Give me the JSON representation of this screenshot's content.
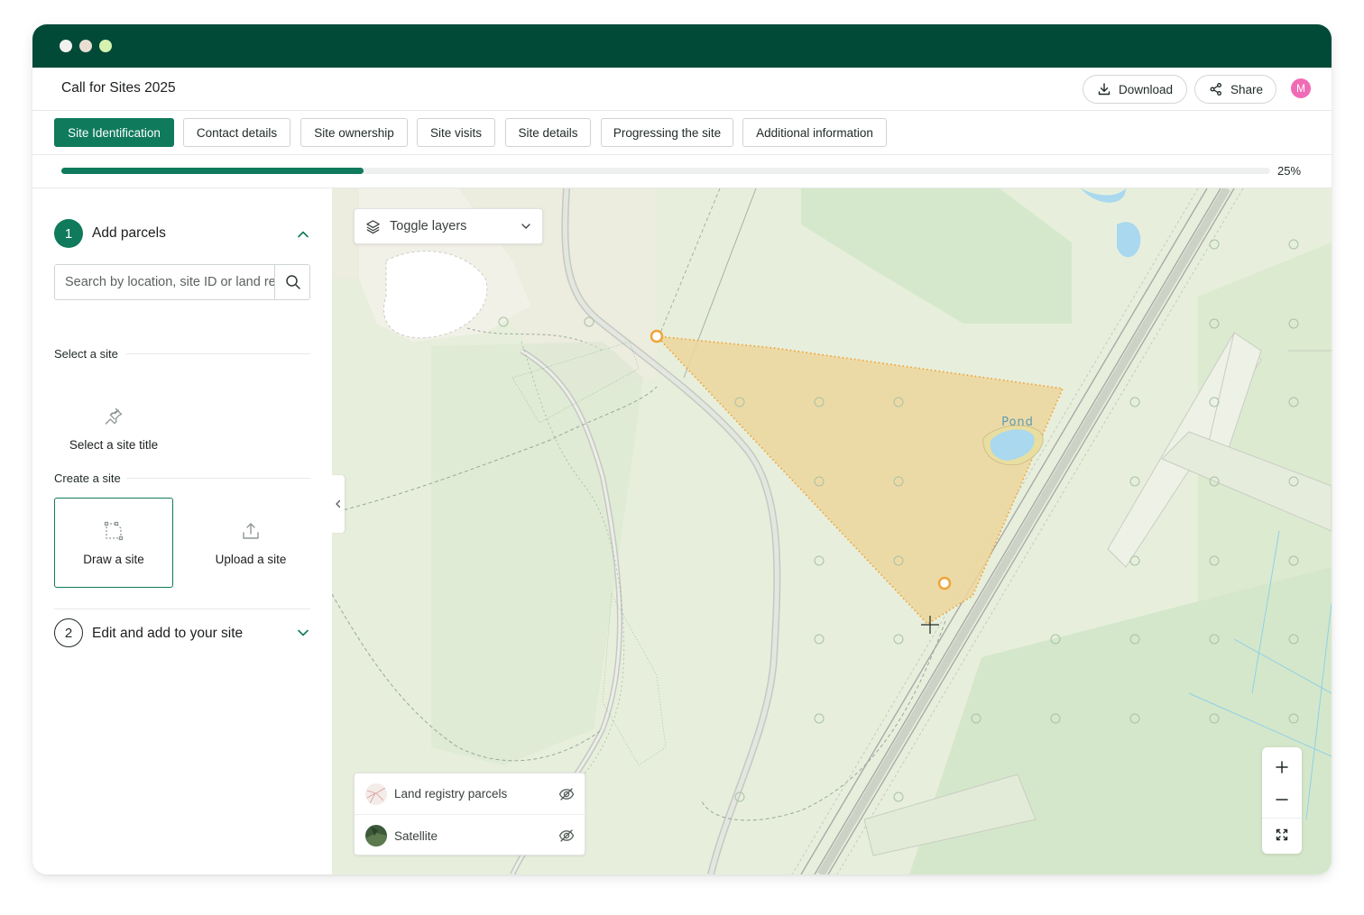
{
  "window": {
    "dots": [
      {
        "name": "window-close-dot",
        "color": "#f1f1ee"
      },
      {
        "name": "window-minimize-dot",
        "color": "#e8dfd2"
      },
      {
        "name": "window-zoom-dot",
        "color": "#d6f2b0"
      }
    ]
  },
  "header": {
    "title": "Call for Sites 2025",
    "download_label": "Download",
    "share_label": "Share",
    "avatar_initial": "M",
    "icons": {
      "download": "download-icon",
      "share": "share-icon"
    }
  },
  "tabs": [
    {
      "label": "Site Identification",
      "active": true
    },
    {
      "label": "Contact details",
      "active": false
    },
    {
      "label": "Site ownership",
      "active": false
    },
    {
      "label": "Site visits",
      "active": false
    },
    {
      "label": "Site details",
      "active": false
    },
    {
      "label": "Progressing the site",
      "active": false
    },
    {
      "label": "Additional information",
      "active": false
    }
  ],
  "progress": {
    "label": "25%",
    "value": 0.25
  },
  "sidebar": {
    "step1": {
      "number": "1",
      "title": "Add parcels",
      "expanded": true
    },
    "search": {
      "placeholder": "Search by location, site ID or land registry title"
    },
    "select_label": "Select a site",
    "select_title_label": "Select a site title",
    "create_label": "Create a site",
    "draw_label": "Draw a site",
    "upload_label": "Upload a site",
    "step2": {
      "number": "2",
      "title": "Edit and add to your site",
      "expanded": false
    }
  },
  "map": {
    "toggle_layers_label": "Toggle layers",
    "feature_label": "Pond",
    "legend": [
      {
        "label": "Land registry parcels",
        "visible": false
      },
      {
        "label": "Satellite",
        "visible": false
      }
    ],
    "colors": {
      "accent": "#0f7a5c",
      "polygon_fill": "#e9d59b",
      "polygon_stroke": "#f0a43a",
      "background": "#e7efdc"
    }
  }
}
